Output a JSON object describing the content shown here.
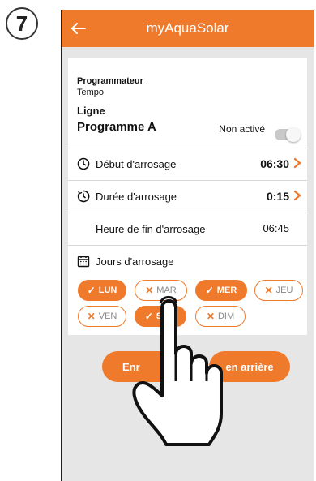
{
  "step_number": "7",
  "app": {
    "title": "myAquaSolar"
  },
  "header": {
    "programmer_label": "Programmateur",
    "programmer_value": "Tempo",
    "line_label": "Ligne",
    "program_name": "Programme A",
    "status_text": "Non activé",
    "toggle_on": false
  },
  "rows": {
    "start": {
      "label": "Début d'arrosage",
      "value": "06:30",
      "icon": "clock-icon"
    },
    "duration": {
      "label": "Durée d'arrosage",
      "value": "0:15",
      "icon": "timer-icon"
    },
    "end": {
      "label": "Heure de fin d'arrosage",
      "value": "06:45"
    },
    "days": {
      "label": "Jours d'arrosage",
      "icon": "calendar-icon"
    }
  },
  "days": [
    {
      "label": "LUN",
      "active": true
    },
    {
      "label": "MAR",
      "active": false
    },
    {
      "label": "MER",
      "active": true
    },
    {
      "label": "JEU",
      "active": false
    },
    {
      "label": "VEN",
      "active": false
    },
    {
      "label": "SAM",
      "active": true
    },
    {
      "label": "DIM",
      "active": false
    }
  ],
  "buttons": {
    "save_label_visible": "Enr",
    "back_label_visible": "en arrière"
  },
  "colors": {
    "accent": "#ef7a2c",
    "background": "#e6e6e6"
  }
}
